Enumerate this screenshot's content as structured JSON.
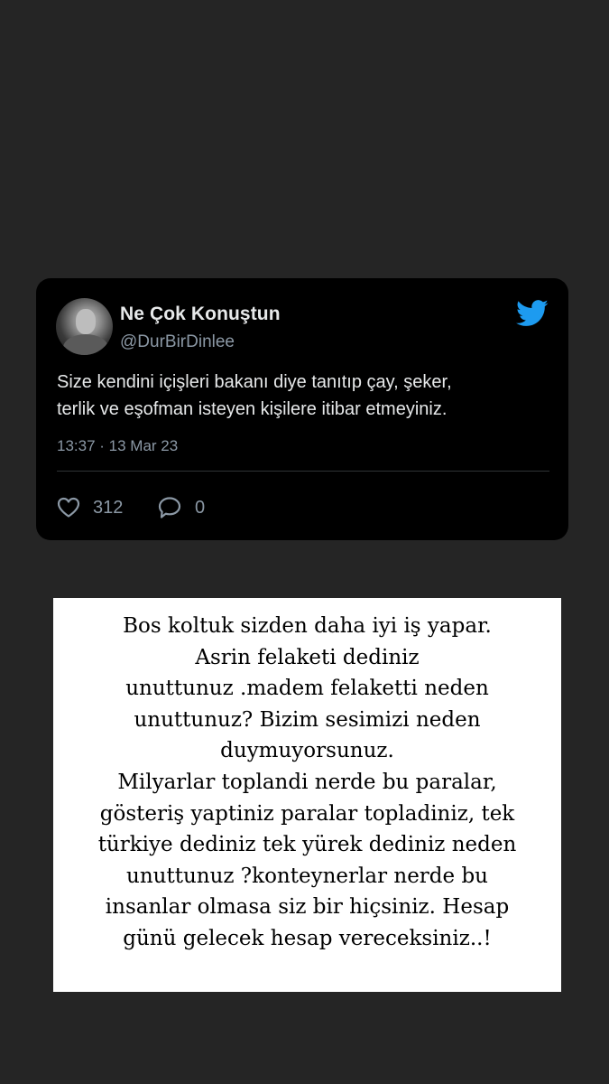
{
  "tweet": {
    "display_name": "Ne Çok Konuştun",
    "handle": "@DurBirDinlee",
    "text_lines": [
      "Size kendini içişleri bakanı diye tanıtıp çay, şeker,",
      "terlik ve eşofman isteyen kişilere itibar etmeyiniz."
    ],
    "timestamp": "13:37 · 13 Mar 23",
    "likes": "312",
    "replies": "0",
    "icons": {
      "brand": "twitter-bird-icon",
      "like": "heart-icon",
      "reply": "speech-bubble-icon"
    },
    "colors": {
      "card_bg": "#000000",
      "twitter_blue": "#1d9bf0",
      "primary_text": "#e7e9ea",
      "secondary_text": "#8b98a5"
    }
  },
  "caption": {
    "lines": [
      "Bos koltuk sizden daha iyi iş yapar.",
      "Asrin felaketi dediniz",
      "unuttunuz .madem felaketti neden",
      "unuttunuz? Bizim sesimizi neden",
      "duymuyorsunuz.",
      "Milyarlar toplandi nerde bu paralar,",
      "gösteriş yaptiniz paralar topladiniz, tek",
      "türkiye dediniz tek yürek dediniz neden",
      "unuttunuz ?konteynerlar nerde  bu",
      "insanlar olmasa siz bir hiçsiniz. Hesap",
      "günü gelecek hesap vereceksiniz..!"
    ],
    "colors": {
      "box_bg": "#ffffff",
      "text": "#000000"
    }
  },
  "background_color": "#252525"
}
